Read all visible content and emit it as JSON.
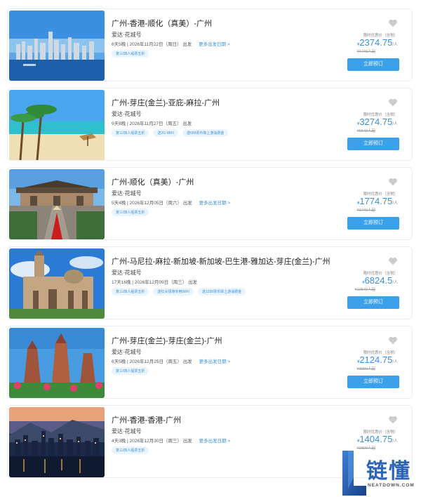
{
  "trips": [
    {
      "title": "广州-香港-顺化（真美）-广州",
      "ship": "爱达·花城号",
      "duration": "6天5晚",
      "date": "2026年11月22日（周日）",
      "depart": "出发",
      "more_dates": "更多出发日期 >",
      "tags": [
        "复三/四人船票五折"
      ],
      "price_label": "限时优惠价（含税）",
      "currency": "¥",
      "price": "2374.75",
      "per": "/人",
      "orig": "¥4749人起",
      "book": "立即预订",
      "scene": "harbor-day"
    },
    {
      "title": "广州-芽庄(金兰)-亚庇-麻拉-广州",
      "ship": "爱达·花城号",
      "duration": "9天8晚",
      "date": "2026年11月27日（周五）",
      "depart": "出发",
      "more_dates": "",
      "tags": [
        "复三/四人船票五折",
        "送2G WIFI",
        "送699票币岸上游消费金"
      ],
      "price_label": "限时优惠价（含税）",
      "currency": "¥",
      "price": "3274.75",
      "per": "/人",
      "orig": "¥6549人起",
      "book": "立即预订",
      "scene": "beach"
    },
    {
      "title": "广州-顺化（真美）-广州",
      "ship": "爱达·花城号",
      "duration": "5天4晚",
      "date": "2026年12月05日（周六）",
      "depart": "出发",
      "more_dates": "更多出发日期 >",
      "tags": [
        "复三/四人船票五折"
      ],
      "price_label": "限时优惠价（含税）",
      "currency": "¥",
      "price": "1774.75",
      "per": "/人",
      "orig": "¥3449人起",
      "book": "立即预订",
      "scene": "temple"
    },
    {
      "title": "广州-马尼拉-麻拉-新加坡-新加坡-巴生港-雅加达-芽庄(金兰)-广州",
      "ship": "爱达·花城号",
      "duration": "17天16晚",
      "date": "2026年12月09日（周三）",
      "depart": "出发",
      "more_dates": "",
      "tags": [
        "复三/四人船票五折",
        "送红尖领港专用WIFI",
        "送1299票币岸上游消费金"
      ],
      "price_label": "限时优惠价（含税）",
      "currency": "¥",
      "price": "6824.5",
      "per": "/人",
      "orig": "¥10549人起",
      "book": "立即预订",
      "scene": "cathedral"
    },
    {
      "title": "广州-芽庄(金兰)-芽庄(金兰)-广州",
      "ship": "爱达·花城号",
      "duration": "6天5晚",
      "date": "2026年12月25日（周五）",
      "depart": "出发",
      "more_dates": "更多出发日期 >",
      "tags": [
        "复三/四人船票五折"
      ],
      "price_label": "限时优惠价（含税）",
      "currency": "¥",
      "price": "2124.75",
      "per": "/人",
      "orig": "¥3999人起",
      "book": "立即预订",
      "scene": "ruins"
    },
    {
      "title": "广州-香港-香港-广州",
      "ship": "爱达·花城号",
      "duration": "4天3晚",
      "date": "2026年12月30日（周三）",
      "depart": "出发",
      "more_dates": "更多出发日期 >",
      "tags": [
        "复三/四人船票五折"
      ],
      "price_label": "限时优惠价（含税）",
      "currency": "¥",
      "price": "1404.75",
      "per": "/人",
      "orig": "¥2809人起",
      "book": "",
      "scene": "harbor-night"
    }
  ],
  "watermark": {
    "cn": "链懂",
    "en": "NEATDOWN.COM"
  },
  "colors": {
    "accent": "#3aa0ea",
    "price": "#3a8fd9",
    "tag_bg": "#eaf4fd",
    "heart": "#cccccc"
  }
}
